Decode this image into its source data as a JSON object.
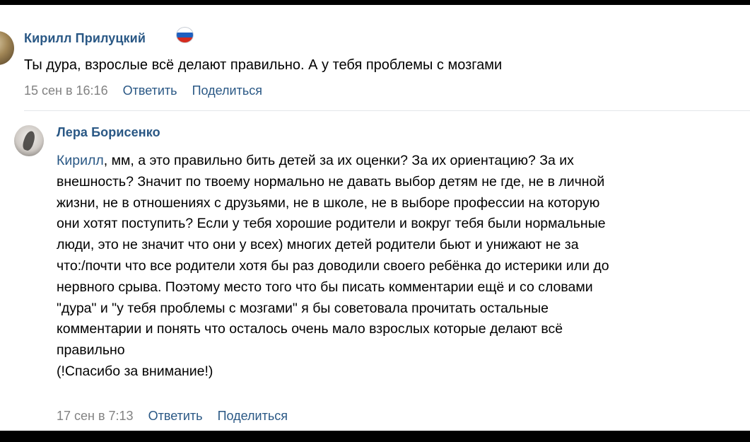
{
  "comment1": {
    "author": "Кирилл Прилуцкий",
    "flag_icon": "russia-flag-icon",
    "text": "Ты дура, взрослые всё делают правильно. А у тебя проблемы с мозгами",
    "date": "15 сен в 16:16",
    "reply_label": "Ответить",
    "share_label": "Поделиться"
  },
  "comment2": {
    "author": "Лера Борисенко",
    "reply_to": "Кирилл",
    "lines": [
      ", мм, а это правильно бить детей за их оценки? За их ориентацию? За их",
      "внешность? Значит по твоему нормально не давать выбор детям не где, не в личной",
      "жизни, не в отношениях с друзьями, не в школе, не в выборе профессии на которую",
      "они хотят поступить? Если у тебя хорошие родители и вокруг тебя были нормальные",
      "люди, это не значит что они у всех) многих детей родители бьют и унижают не за",
      "что:/почти что все родители хотя бы раз доводили своего ребёнка до истерики или до",
      "нервного срыва. Поэтому место того что бы писать комментарии ещё и со словами",
      "\"дура\" и \"у тебя проблемы с мозгами\" я бы советовала прочитать остальные",
      "комментарии и понять что осталось очень мало взрослых которые делают всё",
      "правильно",
      "(!Спасибо за внимание!)"
    ],
    "date": "17 сен в 7:13",
    "reply_label": "Ответить",
    "share_label": "Поделиться"
  },
  "colors": {
    "link": "#2a5885",
    "meta": "#828282",
    "frame": "#000000"
  }
}
